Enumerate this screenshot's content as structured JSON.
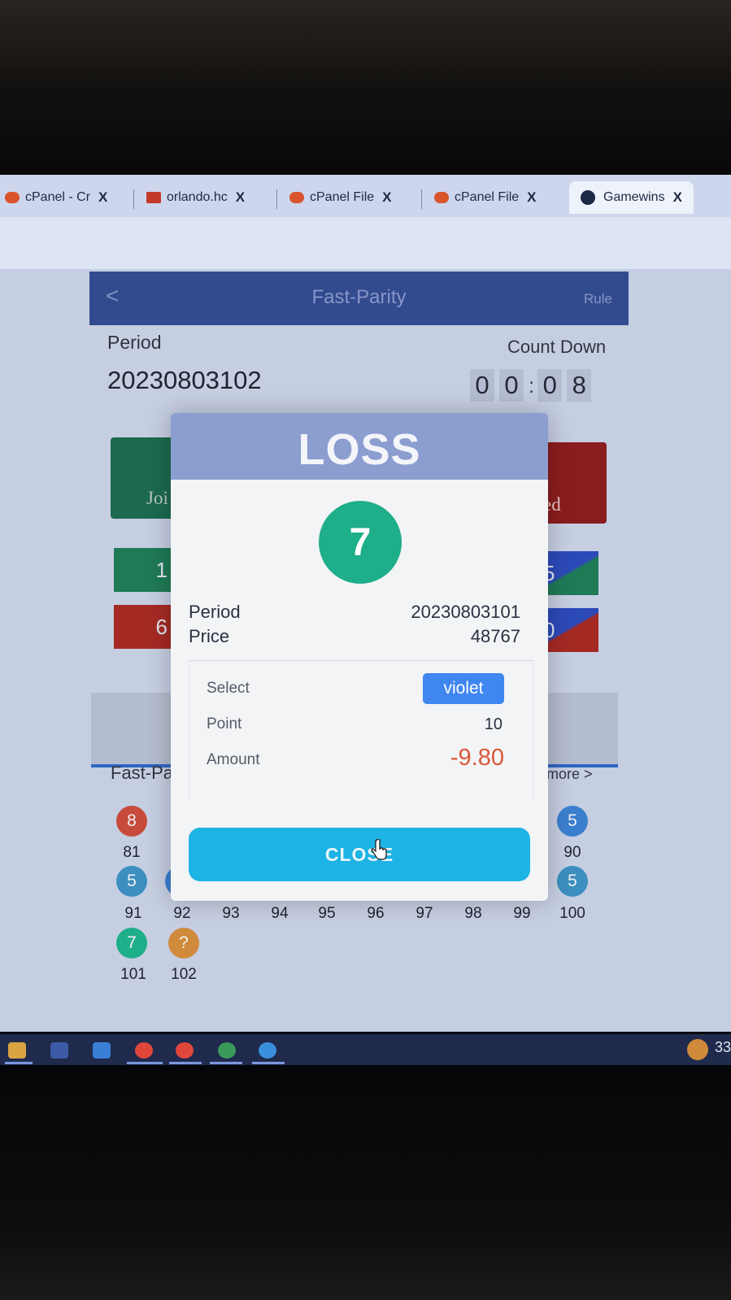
{
  "browser": {
    "tabs": [
      {
        "label": "cPanel - Cr",
        "close": "X"
      },
      {
        "label": "orlando.hc",
        "close": "X"
      },
      {
        "label": "cPanel File",
        "close": "X"
      },
      {
        "label": "cPanel File",
        "close": "X"
      },
      {
        "label": "Gamewins",
        "close": "X",
        "active": true
      }
    ]
  },
  "header": {
    "back": "<",
    "title": "Fast-Parity",
    "rule": "Rule"
  },
  "game": {
    "period_label": "Period",
    "period_value": "20230803102",
    "countdown_label": "Count Down",
    "countdown_digits": [
      "0",
      "0",
      "0",
      "8"
    ],
    "countdown_sep": ":",
    "join_label": "Joi",
    "red_label": "ed",
    "number_cells": [
      "1",
      "5",
      "6",
      "0"
    ],
    "record_label": "Fast-Pa",
    "more_label": "more >"
  },
  "history": {
    "row1": [
      {
        "n": "8",
        "num": "81",
        "color": "#c64b3b"
      },
      {
        "n": "5",
        "num": "90",
        "color": "#3b7fcf"
      }
    ],
    "row2": [
      {
        "n": "5",
        "num": "91",
        "color": "#3c8fc0"
      },
      {
        "n": "",
        "num": "92",
        "color": "#3b7fcf"
      },
      {
        "n": "",
        "num": "93",
        "color": "#c64b3b"
      },
      {
        "n": "",
        "num": "94",
        "color": "#3b7fcf"
      },
      {
        "n": "",
        "num": "95",
        "color": "#3b7fcf"
      },
      {
        "n": "",
        "num": "96",
        "color": "#3b7fcf"
      },
      {
        "n": "",
        "num": "97",
        "color": "#c64b3b"
      },
      {
        "n": "",
        "num": "98",
        "color": "#c64b3b"
      },
      {
        "n": "",
        "num": "99",
        "color": "#1fae8a"
      },
      {
        "n": "5",
        "num": "100",
        "color": "#3c8fc0"
      }
    ],
    "row3": [
      {
        "n": "7",
        "num": "101",
        "color": "#1fae8a"
      },
      {
        "n": "?",
        "num": "102",
        "color": "#d08a3b"
      }
    ]
  },
  "modal": {
    "title": "LOSS",
    "result_number": "7",
    "period_label": "Period",
    "period_value": "20230803101",
    "price_label": "Price",
    "price_value": "48767",
    "select_label": "Select",
    "select_value": "violet",
    "point_label": "Point",
    "point_value": "10",
    "amount_label": "Amount",
    "amount_value": "-9.80",
    "close_label": "CLOSE"
  },
  "taskbar": {
    "clock": "33"
  },
  "colors": {
    "accent": "#1db3e4",
    "loss_header": "#8c9dd0",
    "green": "#1fae8a",
    "red": "#d9583a",
    "violet_tag": "#3f86f0"
  }
}
